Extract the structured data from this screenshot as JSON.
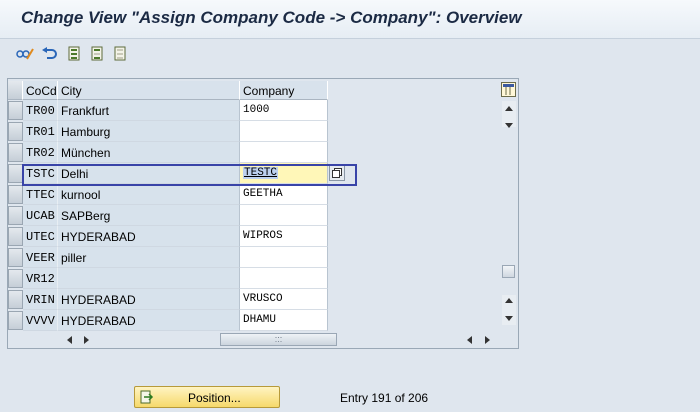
{
  "window": {
    "title": "Change View \"Assign Company Code -> Company\": Overview"
  },
  "toolbar": {
    "buttons": [
      {
        "name": "display-change-icon"
      },
      {
        "name": "undo-icon"
      },
      {
        "name": "select-all-icon"
      },
      {
        "name": "select-block-icon"
      },
      {
        "name": "deselect-all-icon"
      }
    ]
  },
  "table": {
    "columns": [
      "CoCd",
      "City",
      "Company"
    ],
    "rows": [
      {
        "cocd": "TR00",
        "city": "Frankfurt",
        "company": "1000"
      },
      {
        "cocd": "TR01",
        "city": "Hamburg",
        "company": ""
      },
      {
        "cocd": "TR02",
        "city": "München",
        "company": ""
      },
      {
        "cocd": "TSTC",
        "city": "Delhi",
        "company": "TESTC"
      },
      {
        "cocd": "TTEC",
        "city": "kurnool",
        "company": "GEETHA"
      },
      {
        "cocd": "UCAB",
        "city": "SAPBerg",
        "company": ""
      },
      {
        "cocd": "UTEC",
        "city": "HYDERABAD",
        "company": "WIPROS"
      },
      {
        "cocd": "VEER",
        "city": "piller",
        "company": ""
      },
      {
        "cocd": "VR12",
        "city": "",
        "company": ""
      },
      {
        "cocd": "VRIN",
        "city": "HYDERABAD",
        "company": "VRUSCO"
      },
      {
        "cocd": "VVVV",
        "city": "HYDERABAD",
        "company": "DHAMU"
      }
    ],
    "active_row": 3
  },
  "footer": {
    "position_label": "Position...",
    "entry_text": "Entry 191 of 206"
  }
}
